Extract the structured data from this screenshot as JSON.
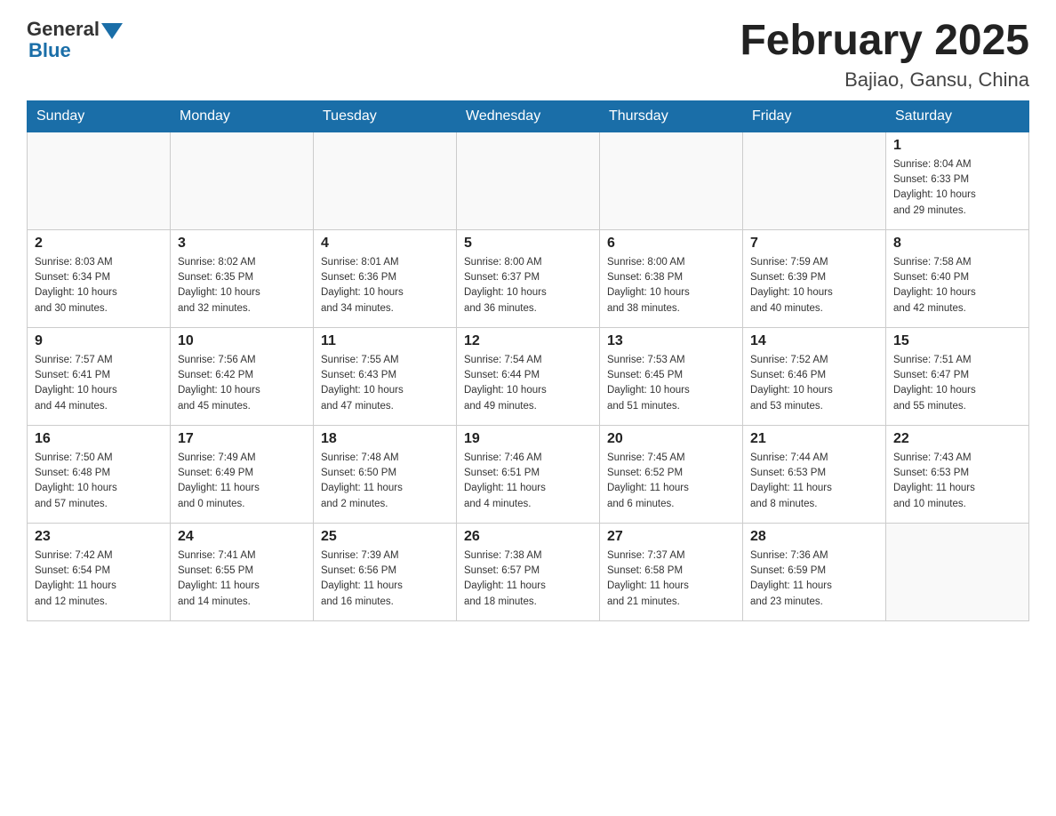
{
  "header": {
    "logo_general": "General",
    "logo_blue": "Blue",
    "title": "February 2025",
    "subtitle": "Bajiao, Gansu, China"
  },
  "days_of_week": [
    "Sunday",
    "Monday",
    "Tuesday",
    "Wednesday",
    "Thursday",
    "Friday",
    "Saturday"
  ],
  "weeks": [
    [
      {
        "day": "",
        "info": ""
      },
      {
        "day": "",
        "info": ""
      },
      {
        "day": "",
        "info": ""
      },
      {
        "day": "",
        "info": ""
      },
      {
        "day": "",
        "info": ""
      },
      {
        "day": "",
        "info": ""
      },
      {
        "day": "1",
        "info": "Sunrise: 8:04 AM\nSunset: 6:33 PM\nDaylight: 10 hours\nand 29 minutes."
      }
    ],
    [
      {
        "day": "2",
        "info": "Sunrise: 8:03 AM\nSunset: 6:34 PM\nDaylight: 10 hours\nand 30 minutes."
      },
      {
        "day": "3",
        "info": "Sunrise: 8:02 AM\nSunset: 6:35 PM\nDaylight: 10 hours\nand 32 minutes."
      },
      {
        "day": "4",
        "info": "Sunrise: 8:01 AM\nSunset: 6:36 PM\nDaylight: 10 hours\nand 34 minutes."
      },
      {
        "day": "5",
        "info": "Sunrise: 8:00 AM\nSunset: 6:37 PM\nDaylight: 10 hours\nand 36 minutes."
      },
      {
        "day": "6",
        "info": "Sunrise: 8:00 AM\nSunset: 6:38 PM\nDaylight: 10 hours\nand 38 minutes."
      },
      {
        "day": "7",
        "info": "Sunrise: 7:59 AM\nSunset: 6:39 PM\nDaylight: 10 hours\nand 40 minutes."
      },
      {
        "day": "8",
        "info": "Sunrise: 7:58 AM\nSunset: 6:40 PM\nDaylight: 10 hours\nand 42 minutes."
      }
    ],
    [
      {
        "day": "9",
        "info": "Sunrise: 7:57 AM\nSunset: 6:41 PM\nDaylight: 10 hours\nand 44 minutes."
      },
      {
        "day": "10",
        "info": "Sunrise: 7:56 AM\nSunset: 6:42 PM\nDaylight: 10 hours\nand 45 minutes."
      },
      {
        "day": "11",
        "info": "Sunrise: 7:55 AM\nSunset: 6:43 PM\nDaylight: 10 hours\nand 47 minutes."
      },
      {
        "day": "12",
        "info": "Sunrise: 7:54 AM\nSunset: 6:44 PM\nDaylight: 10 hours\nand 49 minutes."
      },
      {
        "day": "13",
        "info": "Sunrise: 7:53 AM\nSunset: 6:45 PM\nDaylight: 10 hours\nand 51 minutes."
      },
      {
        "day": "14",
        "info": "Sunrise: 7:52 AM\nSunset: 6:46 PM\nDaylight: 10 hours\nand 53 minutes."
      },
      {
        "day": "15",
        "info": "Sunrise: 7:51 AM\nSunset: 6:47 PM\nDaylight: 10 hours\nand 55 minutes."
      }
    ],
    [
      {
        "day": "16",
        "info": "Sunrise: 7:50 AM\nSunset: 6:48 PM\nDaylight: 10 hours\nand 57 minutes."
      },
      {
        "day": "17",
        "info": "Sunrise: 7:49 AM\nSunset: 6:49 PM\nDaylight: 11 hours\nand 0 minutes."
      },
      {
        "day": "18",
        "info": "Sunrise: 7:48 AM\nSunset: 6:50 PM\nDaylight: 11 hours\nand 2 minutes."
      },
      {
        "day": "19",
        "info": "Sunrise: 7:46 AM\nSunset: 6:51 PM\nDaylight: 11 hours\nand 4 minutes."
      },
      {
        "day": "20",
        "info": "Sunrise: 7:45 AM\nSunset: 6:52 PM\nDaylight: 11 hours\nand 6 minutes."
      },
      {
        "day": "21",
        "info": "Sunrise: 7:44 AM\nSunset: 6:53 PM\nDaylight: 11 hours\nand 8 minutes."
      },
      {
        "day": "22",
        "info": "Sunrise: 7:43 AM\nSunset: 6:53 PM\nDaylight: 11 hours\nand 10 minutes."
      }
    ],
    [
      {
        "day": "23",
        "info": "Sunrise: 7:42 AM\nSunset: 6:54 PM\nDaylight: 11 hours\nand 12 minutes."
      },
      {
        "day": "24",
        "info": "Sunrise: 7:41 AM\nSunset: 6:55 PM\nDaylight: 11 hours\nand 14 minutes."
      },
      {
        "day": "25",
        "info": "Sunrise: 7:39 AM\nSunset: 6:56 PM\nDaylight: 11 hours\nand 16 minutes."
      },
      {
        "day": "26",
        "info": "Sunrise: 7:38 AM\nSunset: 6:57 PM\nDaylight: 11 hours\nand 18 minutes."
      },
      {
        "day": "27",
        "info": "Sunrise: 7:37 AM\nSunset: 6:58 PM\nDaylight: 11 hours\nand 21 minutes."
      },
      {
        "day": "28",
        "info": "Sunrise: 7:36 AM\nSunset: 6:59 PM\nDaylight: 11 hours\nand 23 minutes."
      },
      {
        "day": "",
        "info": ""
      }
    ]
  ]
}
